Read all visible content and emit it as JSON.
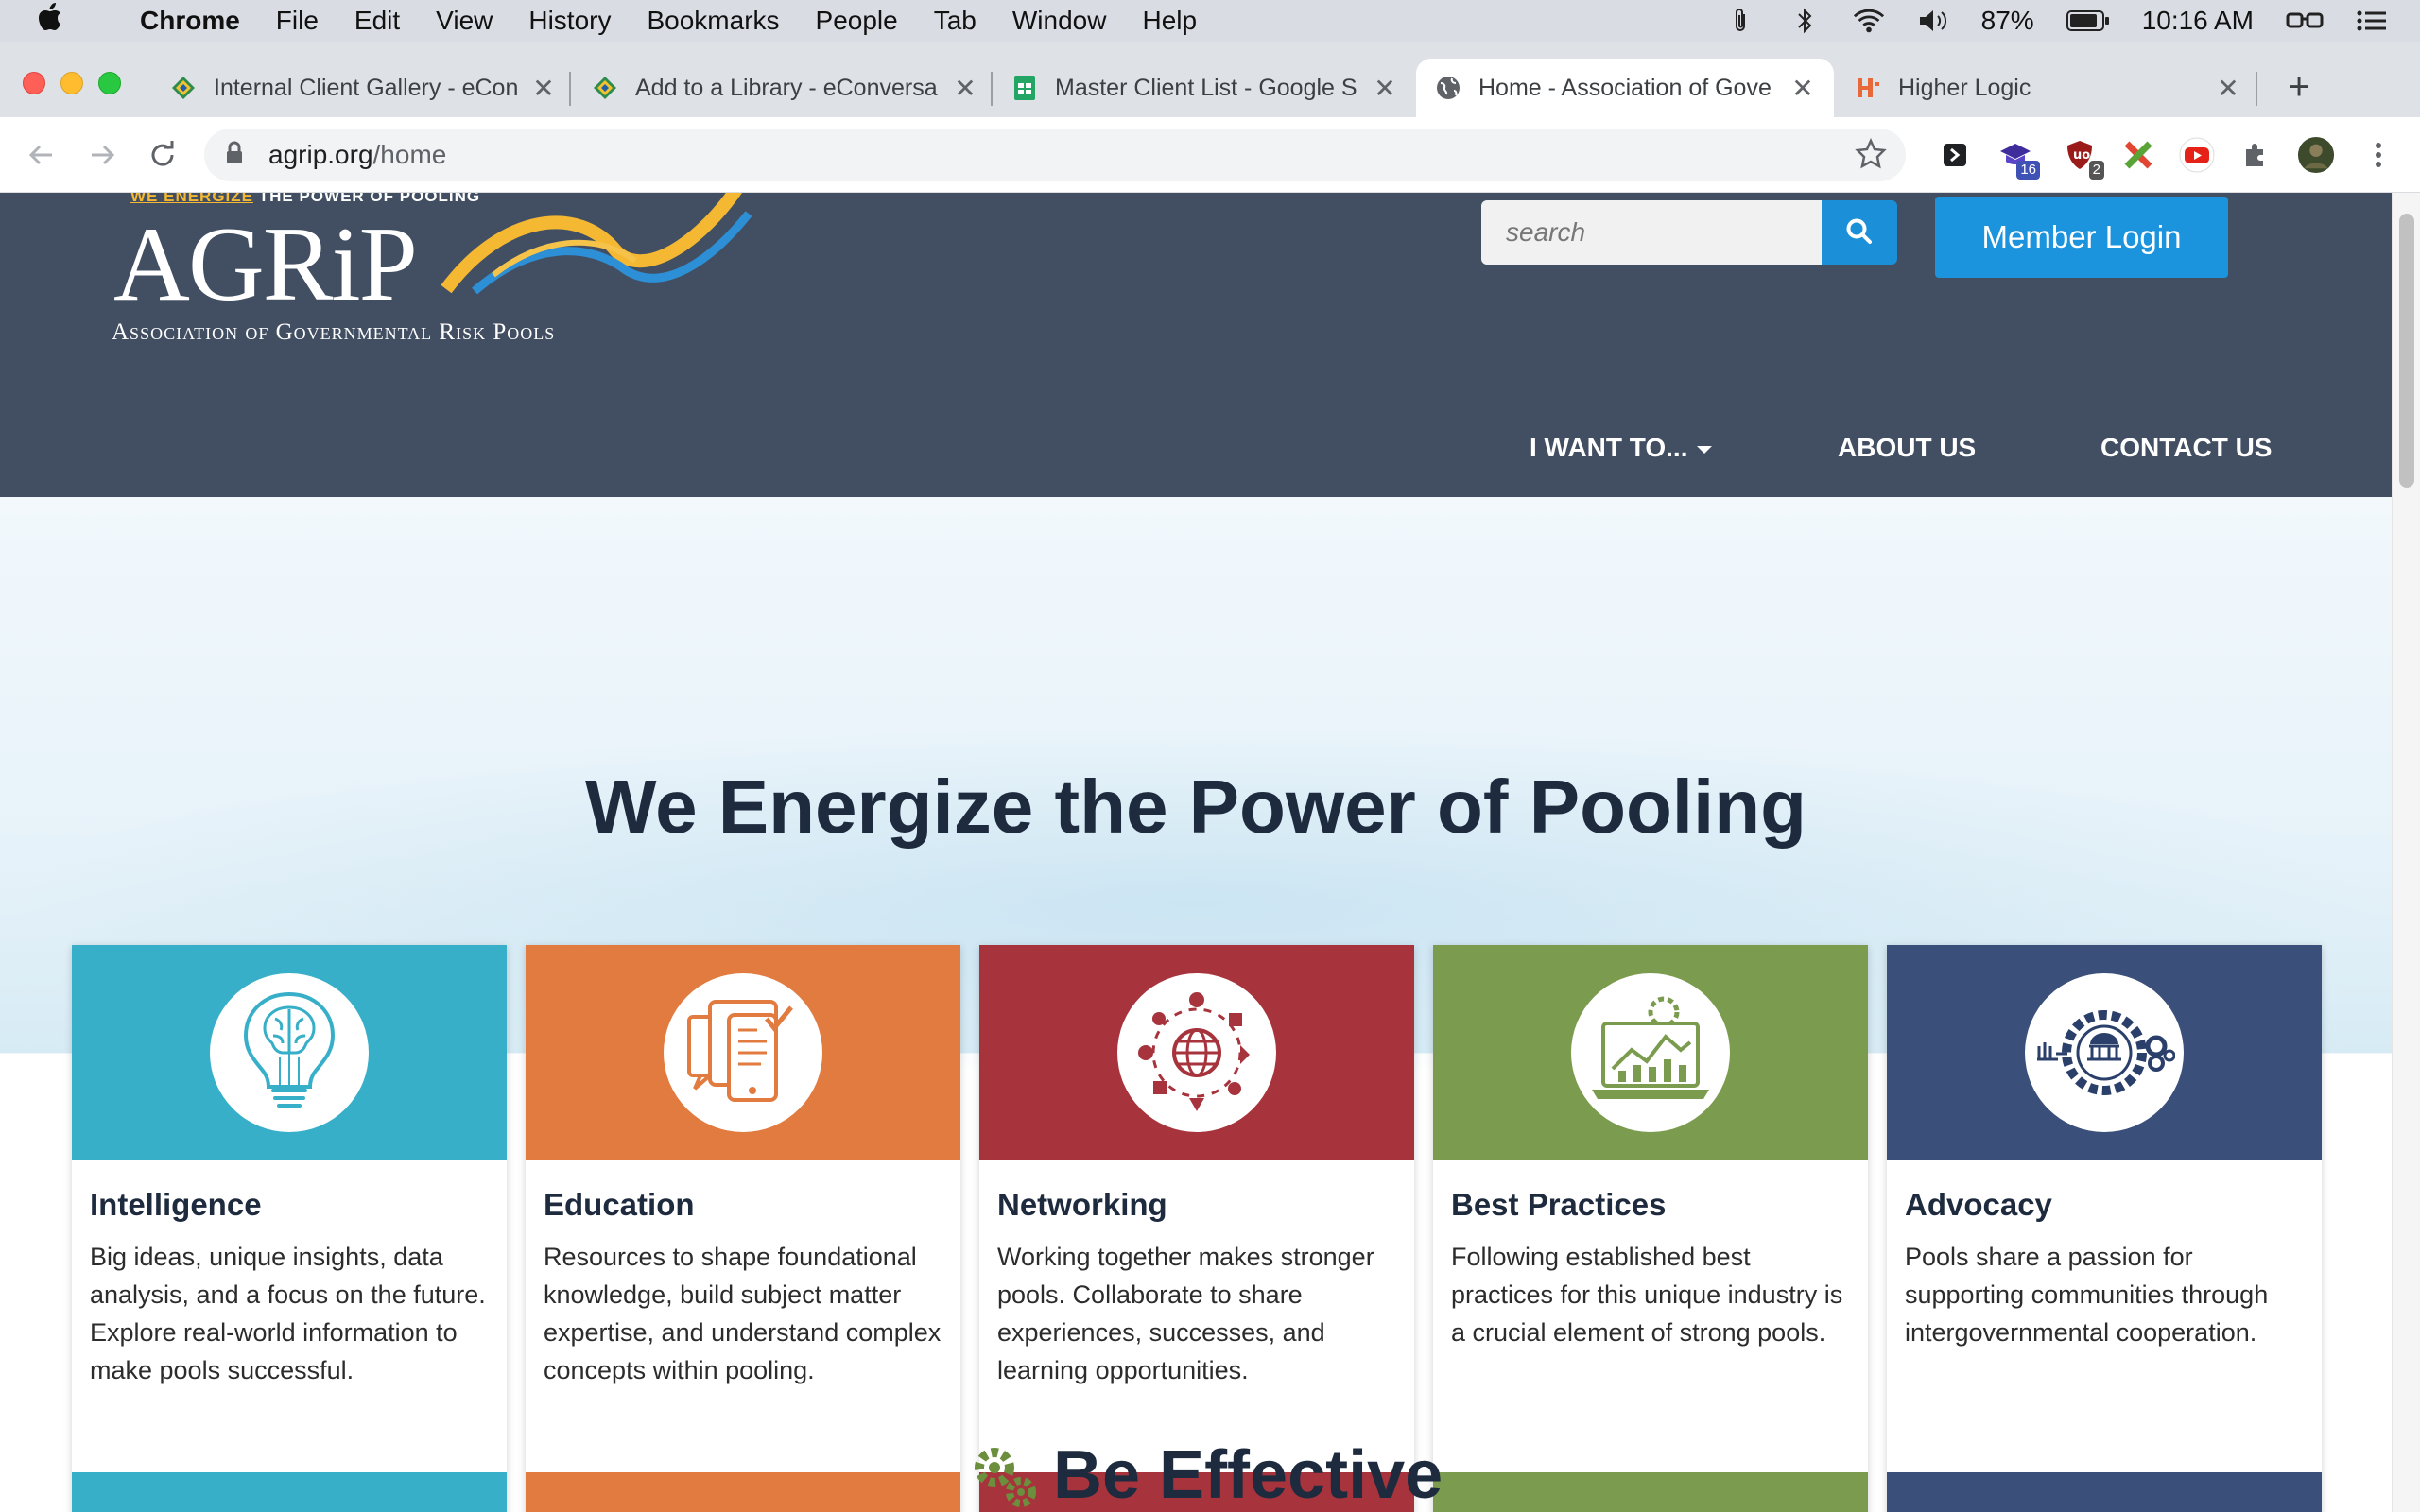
{
  "menubar": {
    "app": "Chrome",
    "items": [
      "File",
      "Edit",
      "View",
      "History",
      "Bookmarks",
      "People",
      "Tab",
      "Window",
      "Help"
    ],
    "battery": "87%",
    "time": "10:16 AM"
  },
  "tabs": [
    {
      "title": "Internal Client Gallery - eCon",
      "favicon": "econversations-icon"
    },
    {
      "title": "Add to a Library - eConversa",
      "favicon": "econversations-icon"
    },
    {
      "title": "Master Client List - Google S",
      "favicon": "google-sheets-icon"
    },
    {
      "title": "Home - Association of Gove",
      "favicon": "globe-icon",
      "active": true
    },
    {
      "title": "Higher Logic",
      "favicon": "higher-logic-icon"
    }
  ],
  "omnibox": {
    "host": "agrip.org",
    "path": "/home"
  },
  "extensions": {
    "badge1": "16",
    "badge2": "2"
  },
  "site": {
    "logo": {
      "tagline_pre": "WE ENERGIZE",
      "tagline_post": " THE POWER OF POOLING",
      "wordmark": "AGRiP",
      "subtitle": "Association of Governmental Risk Pools"
    },
    "search_placeholder": "search",
    "member_login": "Member Login",
    "nav": {
      "i_want_to": "I WANT TO...",
      "about": "ABOUT US",
      "contact": "CONTACT US"
    },
    "hero_title": "We Energize the Power of Pooling",
    "cards": [
      {
        "title": "Intelligence",
        "body": "Big ideas, unique insights, data analysis, and a focus on the future. Explore real-world information to make pools successful.",
        "color": "#37afc8",
        "icon": "lightbulb-brain-icon"
      },
      {
        "title": "Education",
        "body": "Resources to shape foundational knowledge, build subject matter expertise, and understand complex concepts within pooling.",
        "color": "#e27b40",
        "icon": "documents-tablet-icon"
      },
      {
        "title": "Networking",
        "body": "Working together makes stronger pools. Collaborate to share experiences, successes, and learning opportunities.",
        "color": "#a7343d",
        "icon": "globe-network-icon"
      },
      {
        "title": "Best Practices",
        "body": "Following established best practices for this unique industry is a crucial element of strong pools.",
        "color": "#7b9c4e",
        "icon": "laptop-chart-gear-icon"
      },
      {
        "title": "Advocacy",
        "body": "Pools share a passion for supporting communities through intergovernmental cooperation.",
        "color": "#3a4f7a",
        "icon": "capitol-gears-icon"
      }
    ],
    "section_title": "Be Effective"
  }
}
